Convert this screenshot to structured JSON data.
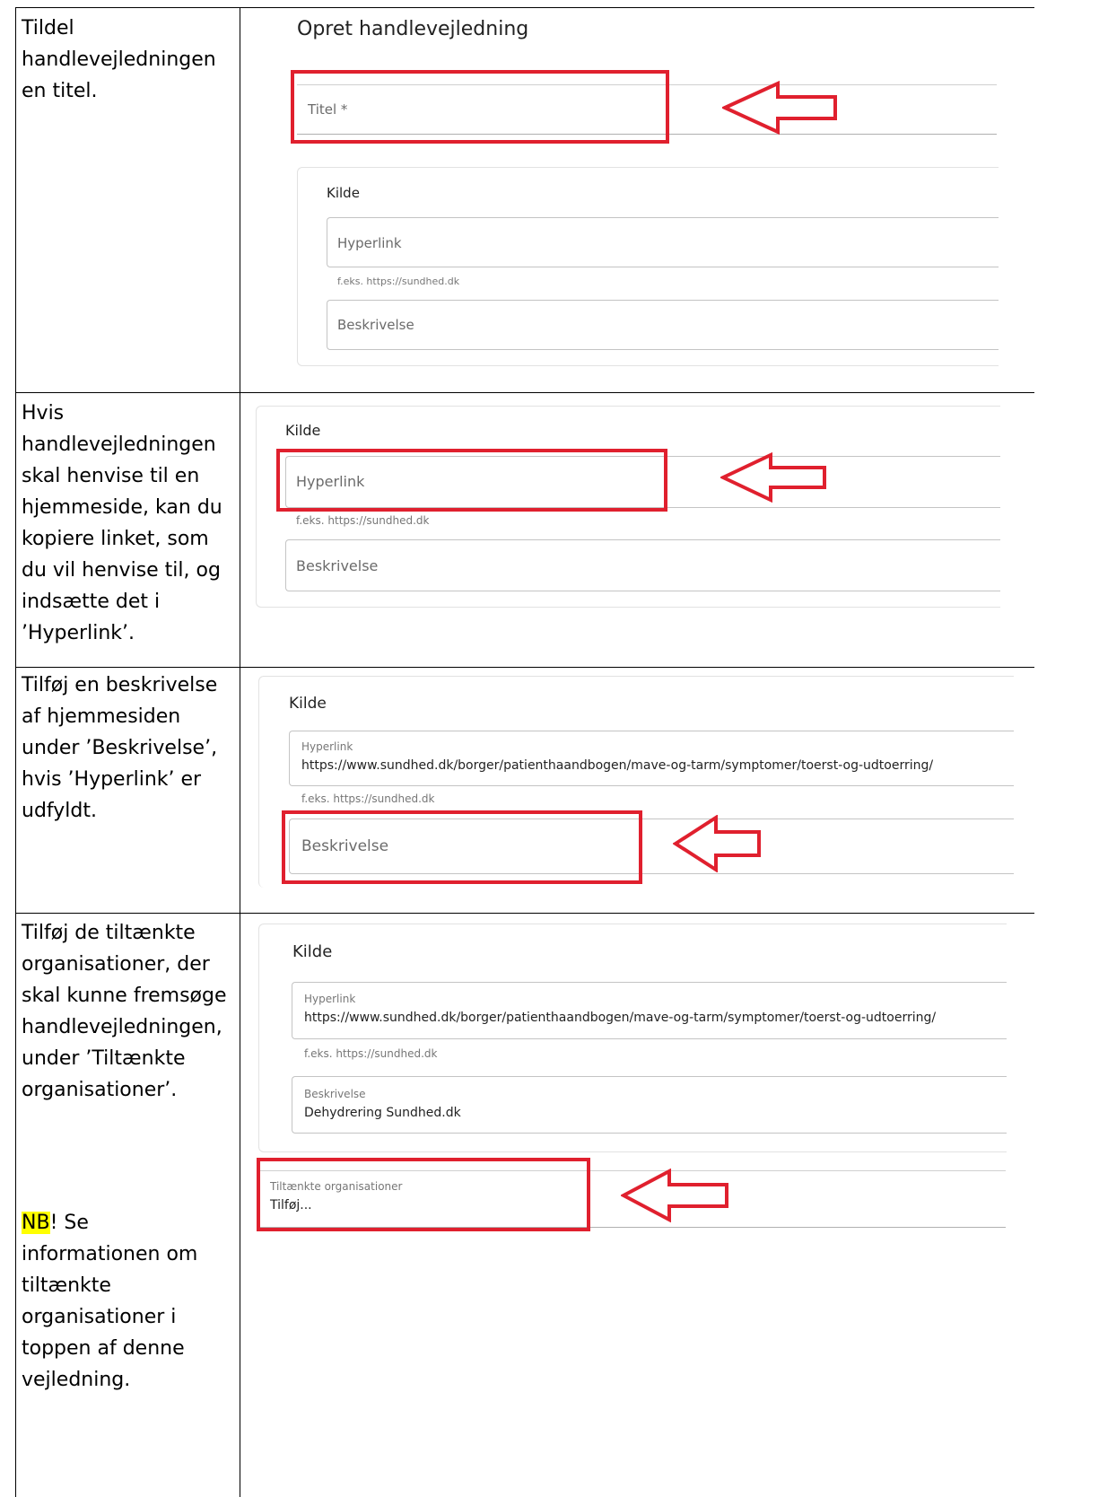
{
  "rows": [
    {
      "instruction": "Tildel handlevejledningen en titel.",
      "form": {
        "title": "Opret handlevejledning",
        "title_field_label": "Titel *",
        "source_heading": "Kilde",
        "hyperlink_label": "Hyperlink",
        "hyperlink_hint": "f.eks. https://sundhed.dk",
        "description_label": "Beskrivelse"
      }
    },
    {
      "instruction": "Hvis handlevejledningen skal henvise til en hjemmeside, kan du kopiere linket, som du vil henvise til, og indsætte det i ’Hyperlink’.",
      "form": {
        "source_heading": "Kilde",
        "hyperlink_label": "Hyperlink",
        "hyperlink_hint": "f.eks. https://sundhed.dk",
        "description_label": "Beskrivelse"
      }
    },
    {
      "instruction": "Tilføj en beskrivelse af hjemmesiden under ’Beskrivelse’, hvis ’Hyperlink’ er udfyldt.",
      "form": {
        "source_heading": "Kilde",
        "hyperlink_label": "Hyperlink",
        "hyperlink_value": "https://www.sundhed.dk/borger/patienthaandbogen/mave-og-tarm/symptomer/toerst-og-udtoerring/",
        "hyperlink_hint": "f.eks. https://sundhed.dk",
        "description_label": "Beskrivelse"
      }
    },
    {
      "instruction": "Tilføj de tiltænkte organisationer, der skal kunne fremsøge handlevejledningen, under ’Tiltænkte organisationer’.",
      "note_highlight": "NB",
      "note_text": "! Se informationen om tiltænkte organisationer i toppen af denne vejledning.",
      "form": {
        "source_heading": "Kilde",
        "hyperlink_label": "Hyperlink",
        "hyperlink_value": "https://www.sundhed.dk/borger/patienthaandbogen/mave-og-tarm/symptomer/toerst-og-udtoerring/",
        "hyperlink_hint": "f.eks. https://sundhed.dk",
        "description_label": "Beskrivelse",
        "description_value": "Dehydrering Sundhed.dk",
        "organisations_label": "Tiltænkte organisationer",
        "organisations_value": "Tilføj..."
      }
    }
  ],
  "colors": {
    "highlight_box": "#e0202e",
    "note_highlight": "#ffff00"
  }
}
